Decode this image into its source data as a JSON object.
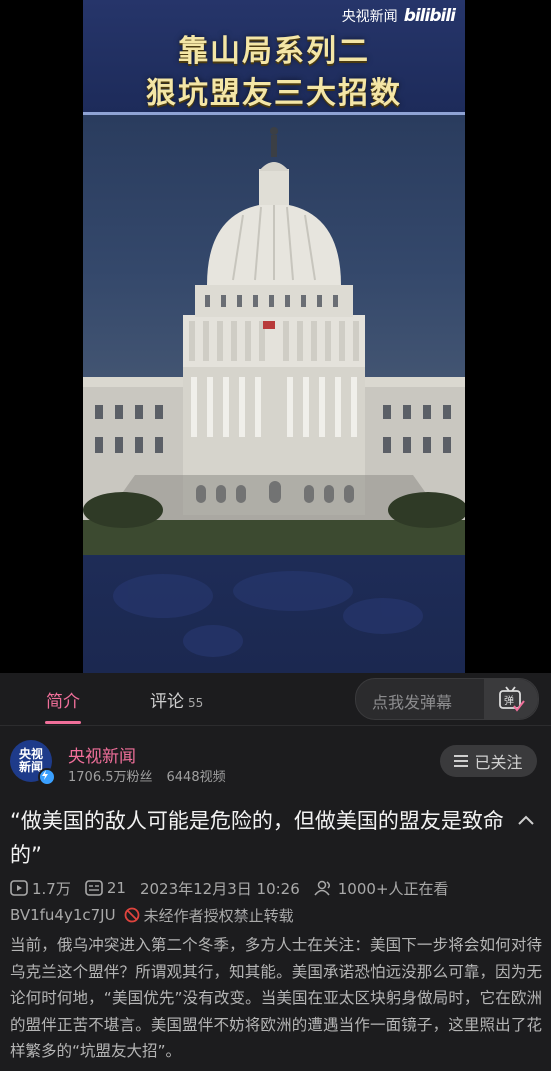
{
  "video": {
    "overlay_title_line1": "靠山局系列二",
    "overlay_title_line2": "狠坑盟友三大招数",
    "watermark_channel": "央视新闻",
    "watermark_logo": "bilibili"
  },
  "tabs": {
    "intro_label": "简介",
    "comments_label": "评论",
    "comments_count": "55"
  },
  "danmaku": {
    "placeholder": "点我发弹幕",
    "button_glyph": "弹"
  },
  "uploader": {
    "avatar_text": "央视新闻",
    "name": "央视新闻",
    "fans": "1706.5万粉丝",
    "videos": "6448视频",
    "follow_label": "已关注"
  },
  "title": "“做美国的敌人可能是危险的，但做美国的盟友是致命的”",
  "meta": {
    "plays": "1.7万",
    "danmaku_count": "21",
    "date": "2023年12月3日 10:26",
    "watching": "1000+人正在看",
    "bvid": "BV1fu4y1c7JU",
    "repost_notice": "未经作者授权禁止转载"
  },
  "description": "当前，俄乌冲突进入第二个冬季，多方人士在关注：美国下一步将会如何对待乌克兰这个盟伴？所谓观其行，知其能。美国承诺恐怕远没那么可靠，因为无论何时何地，“美国优先”没有改变。当美国在亚太区块躬身做局时，它在欧洲的盟伴正苦不堪言。美国盟伴不妨将欧洲的遭遇当作一面镜子，这里照出了花样繁多的“坑盟友大招”。",
  "colors": {
    "accent_pink": "#f06f9a",
    "background": "#1c1c1e",
    "banner_blue": "#1d2b5a",
    "title_gold": "#f4e6a6"
  }
}
